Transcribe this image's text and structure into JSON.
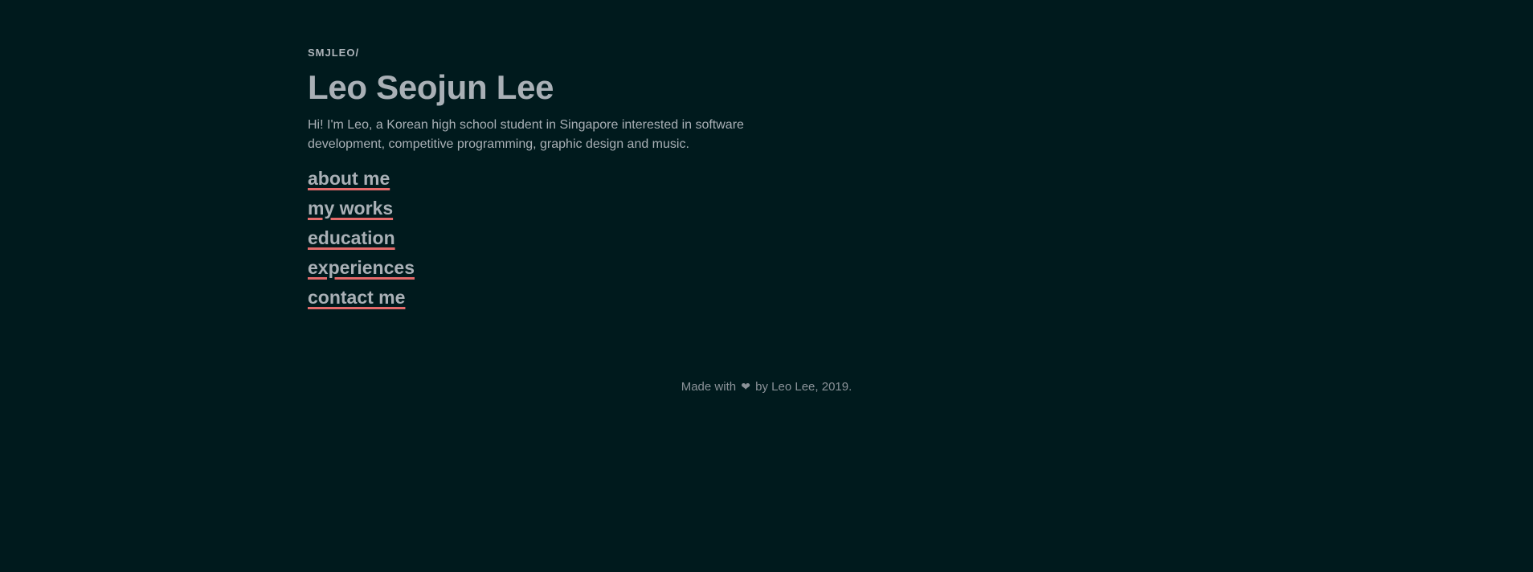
{
  "header": {
    "breadcrumb": "SMJLEO/",
    "title": "Leo Seojun Lee",
    "intro": "Hi! I'm Leo, a Korean high school student in Singapore interested in software development, competitive programming, graphic design and music."
  },
  "nav": {
    "items": [
      {
        "label": "about me"
      },
      {
        "label": "my works"
      },
      {
        "label": "education"
      },
      {
        "label": "experiences"
      },
      {
        "label": "contact me"
      }
    ]
  },
  "footer": {
    "prefix": "Made with",
    "heart_icon": "heart-icon",
    "suffix": "by Leo Lee, 2019."
  },
  "colors": {
    "background": "#001a1d",
    "text": "#a9b0b6",
    "accent_underline": "#e46b6b"
  }
}
